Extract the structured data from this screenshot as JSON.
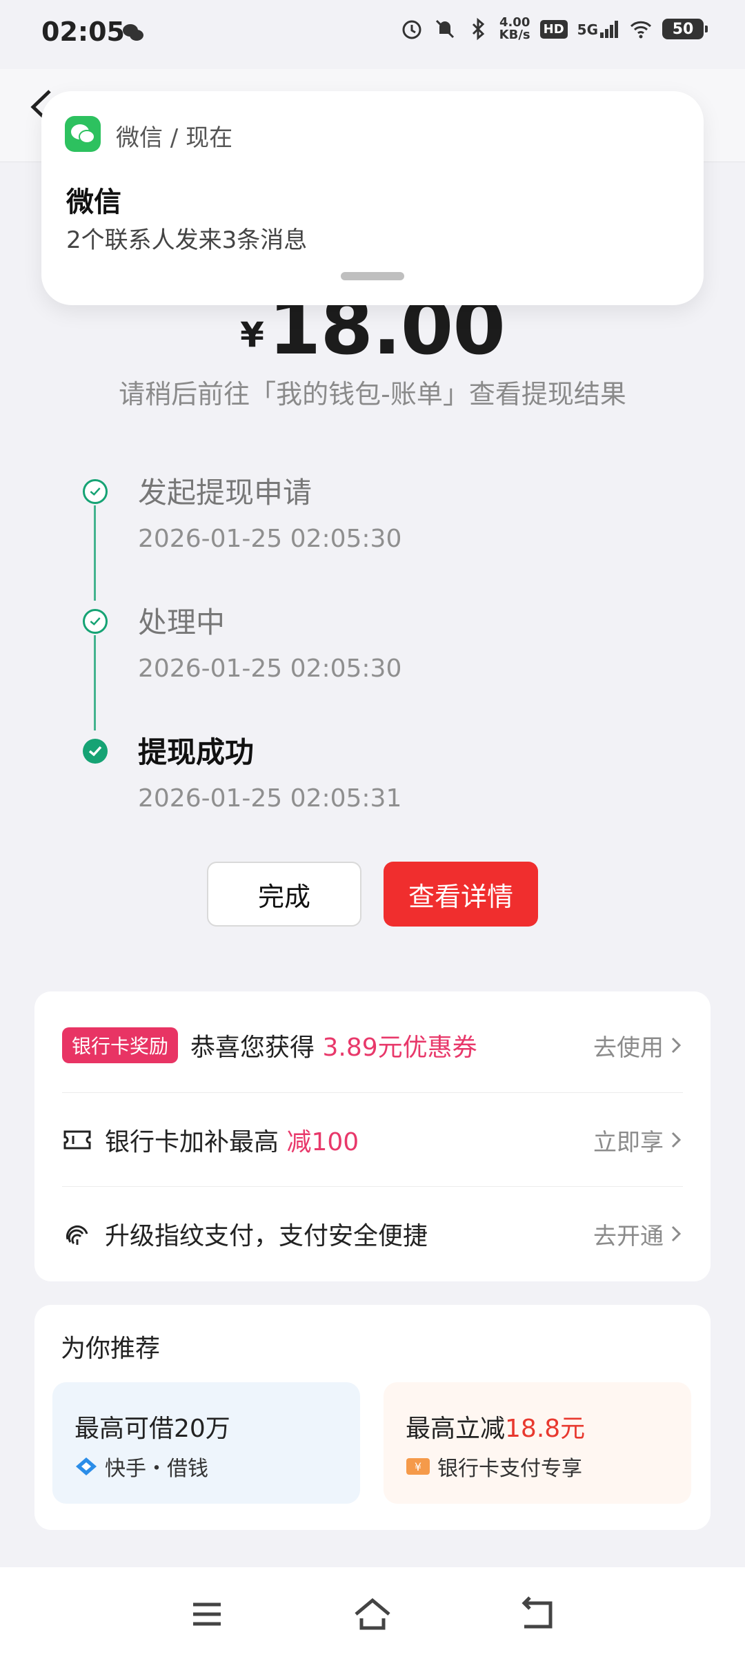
{
  "status": {
    "time": "02:05",
    "net_speed_value": "4.00",
    "net_speed_unit": "KB/s",
    "hd_label": "HD",
    "network": "5G",
    "battery": "50"
  },
  "notification": {
    "app_line": "微信 / 现在",
    "title": "微信",
    "body": "2个联系人发来3条消息"
  },
  "amount": {
    "currency": "¥",
    "value": "18.00"
  },
  "hint": "请稍后前往「我的钱包-账单」查看提现结果",
  "timeline": [
    {
      "title": "发起提现申请",
      "time": "2026-01-25 02:05:30"
    },
    {
      "title": "处理中",
      "time": "2026-01-25 02:05:30"
    },
    {
      "title": "提现成功",
      "time": "2026-01-25 02:05:31"
    }
  ],
  "buttons": {
    "done": "完成",
    "detail": "查看详情"
  },
  "rewards": {
    "badge": "银行卡奖励",
    "row1_text": "恭喜您获得 ",
    "row1_highlight": "3.89元优惠券",
    "row1_action": "去使用",
    "row2_text": "银行卡加补最高 ",
    "row2_highlight": "减100",
    "row2_action": "立即享",
    "row3_text": "升级指纹支付，支付安全便捷",
    "row3_action": "去开通"
  },
  "recommend": {
    "title": "为你推荐",
    "left_main": "最高可借20万",
    "left_sub": "快手・借钱",
    "right_main_prefix": "最高立减",
    "right_main_highlight": "18.8元",
    "right_sub": "银行卡支付专享"
  },
  "colors": {
    "accent_green": "#16a374",
    "primary_red": "#f02e2e",
    "highlight_pink": "#e8386a"
  }
}
